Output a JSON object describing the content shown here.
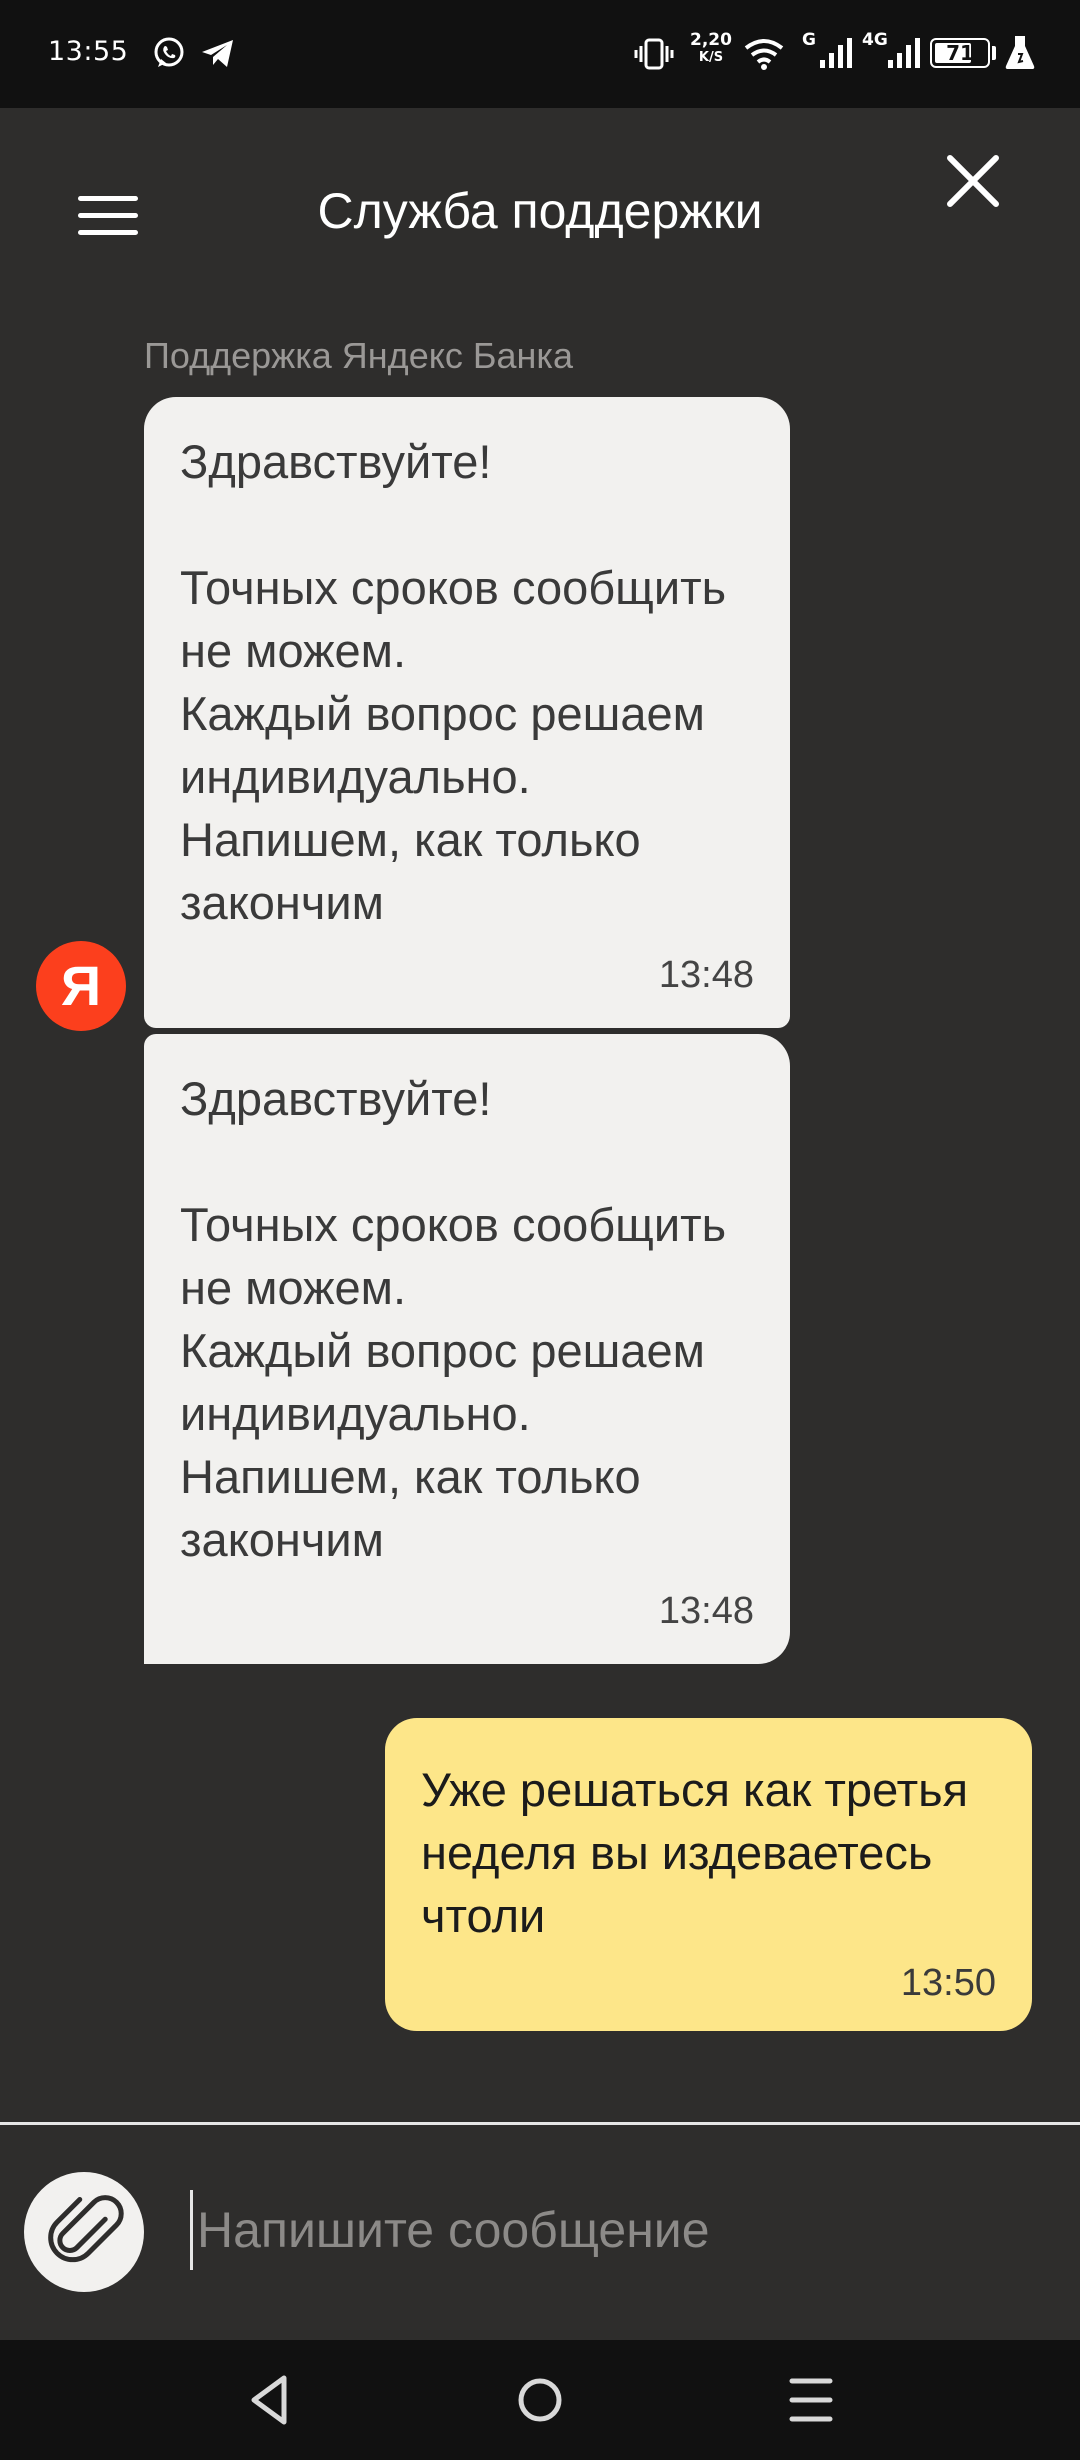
{
  "status_bar": {
    "time": "13:55",
    "net_speed_value": "2,20",
    "net_speed_unit": "K/S",
    "signal_1_label": "G",
    "signal_2_label": "4G",
    "battery_percent": "71",
    "battery_level": 0.71,
    "icons": [
      "whatsapp-icon",
      "telegram-icon",
      "vibrate-icon",
      "wifi-icon",
      "signal-icon",
      "signal-icon",
      "battery-icon",
      "flask-icon"
    ]
  },
  "header": {
    "title": "Служба поддержки",
    "icons": [
      "menu-icon",
      "close-icon"
    ]
  },
  "chat": {
    "sender_name": "Поддержка Яндекс Банка",
    "avatar_letter": "Я",
    "avatar_color": "#fc3f1d",
    "messages": [
      {
        "direction": "incoming",
        "text": "Здравствуйте!\n\nТочных сроков сообщить не можем.\nКаждый вопрос решаем индивидуально.\nНапишем, как только закончим",
        "time": "13:48"
      },
      {
        "direction": "incoming",
        "text": "Здравствуйте!\n\nТочных сроков сообщить не можем.\nКаждый вопрос решаем индивидуально.\nНапишем, как только закончим",
        "time": "13:48"
      },
      {
        "direction": "outgoing",
        "text": "Уже решаться как третья неделя вы издеваетесь чтоли",
        "time": "13:50"
      }
    ],
    "colors": {
      "incoming_bubble": "#f2f1ef",
      "outgoing_bubble": "#fde689",
      "background": "#2e2d2c"
    }
  },
  "composer": {
    "placeholder": "Напишите сообщение",
    "value": "",
    "attach_icon": "paperclip-icon"
  },
  "nav_bar": {
    "icons": [
      "back-icon",
      "home-icon",
      "recents-icon"
    ]
  }
}
